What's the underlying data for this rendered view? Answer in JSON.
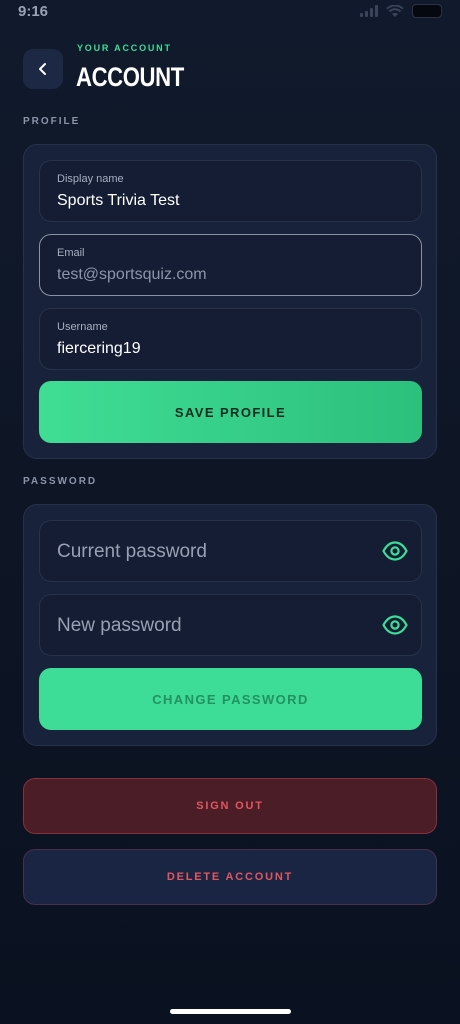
{
  "status_bar": {
    "time": "9:16"
  },
  "header": {
    "subtitle": "YOUR ACCOUNT",
    "title": "ACCOUNT"
  },
  "profile": {
    "section_label": "PROFILE",
    "display_name": {
      "label": "Display name",
      "value": "Sports Trivia Test"
    },
    "email": {
      "label": "Email",
      "value": "test@sportsquiz.com"
    },
    "username": {
      "label": "Username",
      "value": "fiercering19"
    },
    "save_button": "SAVE PROFILE"
  },
  "password": {
    "section_label": "PASSWORD",
    "current_placeholder": "Current password",
    "new_placeholder": "New password",
    "change_button": "CHANGE PASSWORD"
  },
  "actions": {
    "sign_out": "SIGN OUT",
    "delete_account": "DELETE ACCOUNT"
  },
  "colors": {
    "accent": "#3ddc97",
    "background": "#0d1524",
    "card": "#18223a",
    "danger": "#e2565e"
  },
  "icons": [
    "back-chevron-icon",
    "eye-icon",
    "signal-icon",
    "wifi-icon",
    "battery-icon"
  ]
}
